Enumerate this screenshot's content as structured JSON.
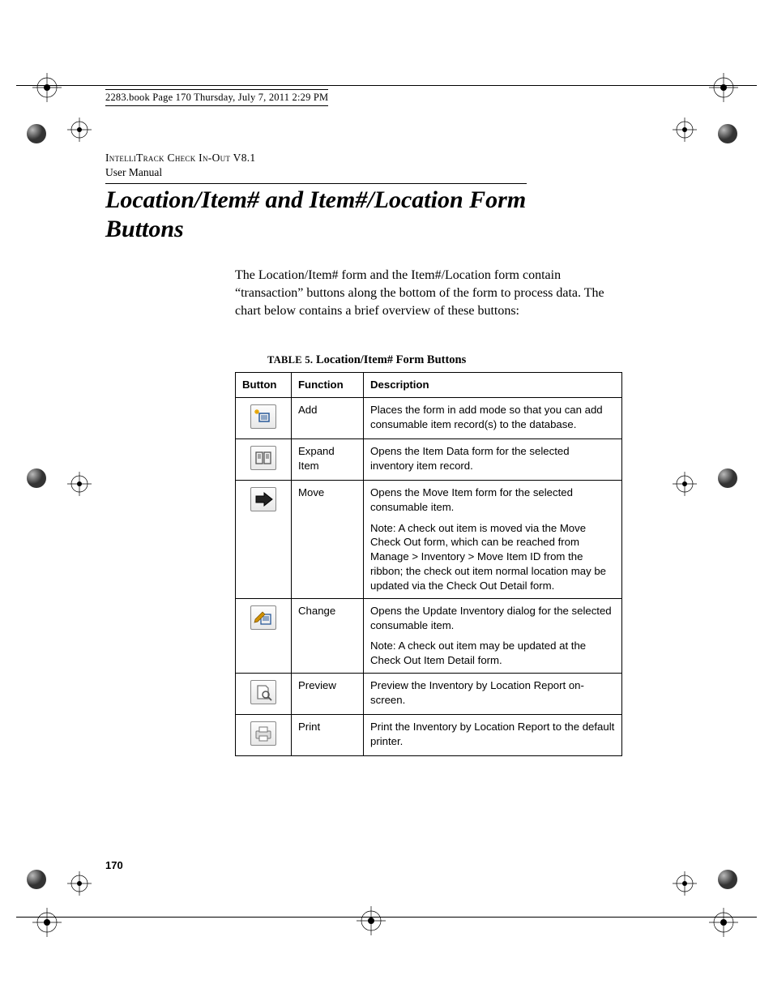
{
  "book_header": "2283.book  Page 170  Thursday, July 7, 2011  2:29 PM",
  "manual_header_line1": "IntelliTrack Check In-Out V8.1",
  "manual_header_line2": "User Manual",
  "section_title": "Location/Item# and Item#/Location Form Buttons",
  "intro": "The Location/Item# form and the Item#/Location form contain “transaction” buttons along the bottom of the form to process data. The chart below contains a brief overview of these buttons:",
  "table_caption_label": "TABLE 5.",
  "table_caption_title": " Location/Item# Form Buttons",
  "columns": {
    "button": "Button",
    "function": "Function",
    "description": "Description"
  },
  "rows": [
    {
      "icon": "add-icon",
      "function": "Add",
      "desc": [
        "Places the form in add mode so that you can add consumable item record(s) to the database."
      ]
    },
    {
      "icon": "expand-item-icon",
      "function": "Expand Item",
      "desc": [
        "Opens the Item Data form for the selected inventory item record."
      ]
    },
    {
      "icon": "move-icon",
      "function": "Move",
      "desc": [
        "Opens the Move Item form for the selected consumable item.",
        "Note: A check out item is moved via the Move Check Out form, which can be reached from Manage > Inventory > Move Item ID from the ribbon; the check out item normal location may be updated via the Check Out Detail form."
      ]
    },
    {
      "icon": "change-icon",
      "function": "Change",
      "desc": [
        "Opens the Update Inventory dialog for the selected consumable item.",
        "Note: A check out item may be updated at the Check Out Item Detail form."
      ]
    },
    {
      "icon": "preview-icon",
      "function": "Preview",
      "desc": [
        "Preview the Inventory by Location Report on-screen."
      ]
    },
    {
      "icon": "print-icon",
      "function": "Print",
      "desc": [
        "Print the Inventory by Location Report to the default printer."
      ]
    }
  ],
  "page_number": "170"
}
